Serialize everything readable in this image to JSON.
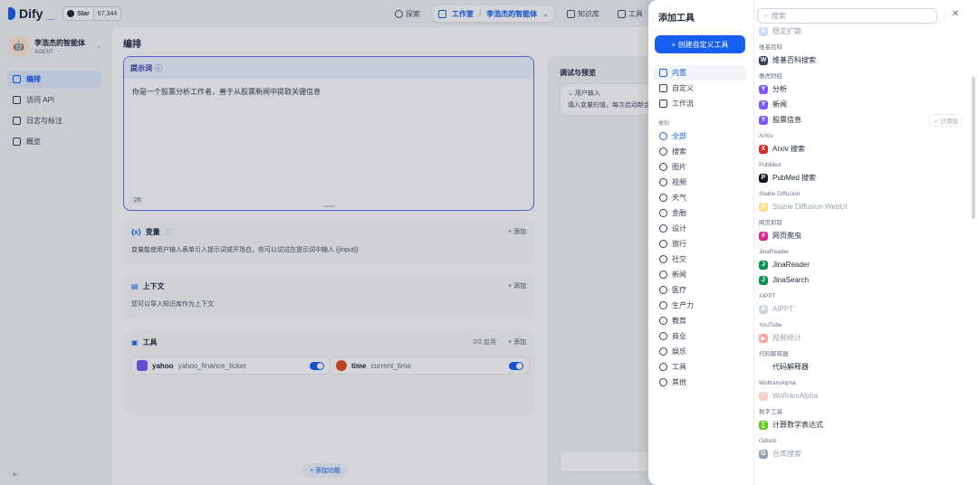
{
  "header": {
    "logo_text": "Dify",
    "logo_underscore": "_",
    "star_label": "Star",
    "star_count": "67,344",
    "nav": [
      {
        "label": "探索",
        "icon": "compass-icon"
      },
      {
        "label": "工作室",
        "icon": "studio-icon"
      },
      {
        "label": "李浩杰的智能体",
        "icon": "chevron-down-icon"
      },
      {
        "label": "知识库",
        "icon": "book-icon"
      },
      {
        "label": "工具",
        "icon": "tool-icon"
      }
    ]
  },
  "sidebar": {
    "app_name": "李浩杰的智能体",
    "app_tag": "AGENT",
    "items": [
      {
        "label": "编排",
        "icon": "orchestrate-icon"
      },
      {
        "label": "访问 API",
        "icon": "api-icon"
      },
      {
        "label": "日志与标注",
        "icon": "log-icon"
      },
      {
        "label": "概览",
        "icon": "overview-icon"
      }
    ],
    "collapse_icon": "collapse-icon"
  },
  "main": {
    "title": "编排",
    "prompt": {
      "label": "提示词",
      "text": "你是一个股票分析工作者，善于从股票新闻中提取关键信息",
      "count": "26"
    },
    "variables": {
      "title": "变量",
      "add": "+ 添加",
      "desc": "变量能使用户输入表单引入提示词或开场白，你可以试试在提示词中输入 {{input}}"
    },
    "context": {
      "title": "上下文",
      "add": "+ 添加",
      "desc": "您可以导入知识库作为上下文"
    },
    "tools": {
      "title": "工具",
      "count": "2/2 启用",
      "add": "+ 添加",
      "items": [
        {
          "name": "yahoo",
          "sub": "yahoo_finance_ticker",
          "color": "#7a5af8"
        },
        {
          "name": "time",
          "sub": "current_time",
          "color": "#e04f16"
        }
      ]
    },
    "add_feature": "+ 添加功能",
    "debug": {
      "title": "调试与预览",
      "user_input": "用户输入",
      "user_input_desc": "填入变量的值，每次启动新会"
    }
  },
  "panel": {
    "title": "添加工具",
    "create_button": "+ 创建自定义工具",
    "types": [
      {
        "label": "内置",
        "icon": "builtin-icon"
      },
      {
        "label": "自定义",
        "icon": "custom-icon"
      },
      {
        "label": "工作流",
        "icon": "workflow-icon"
      }
    ],
    "category_label": "类别",
    "categories": [
      {
        "label": "全部",
        "icon": "grid-icon"
      },
      {
        "label": "搜索",
        "icon": "search-icon"
      },
      {
        "label": "图片",
        "icon": "image-icon"
      },
      {
        "label": "视频",
        "icon": "video-icon"
      },
      {
        "label": "天气",
        "icon": "weather-icon"
      },
      {
        "label": "金融",
        "icon": "finance-icon"
      },
      {
        "label": "设计",
        "icon": "design-icon"
      },
      {
        "label": "旅行",
        "icon": "travel-icon"
      },
      {
        "label": "社交",
        "icon": "social-icon"
      },
      {
        "label": "新闻",
        "icon": "news-icon"
      },
      {
        "label": "医疗",
        "icon": "medical-icon"
      },
      {
        "label": "生产力",
        "icon": "productivity-icon"
      },
      {
        "label": "教育",
        "icon": "education-icon"
      },
      {
        "label": "商业",
        "icon": "business-icon"
      },
      {
        "label": "娱乐",
        "icon": "entertainment-icon"
      },
      {
        "label": "工具",
        "icon": "tool-icon"
      },
      {
        "label": "其他",
        "icon": "other-icon"
      }
    ],
    "search_placeholder": "搜索",
    "groups": [
      {
        "label": "",
        "tools": [
          {
            "name": "稳定扩散",
            "icon": "S",
            "color": "#c7d7fe",
            "dim": true
          }
        ]
      },
      {
        "label": "维基百科",
        "tools": [
          {
            "name": "维基百科搜索",
            "icon": "W",
            "color": "#344054"
          }
        ]
      },
      {
        "label": "雅虎财经",
        "tools": [
          {
            "name": "分析",
            "icon": "Y",
            "color": "#7a5af8"
          },
          {
            "name": "新闻",
            "icon": "Y",
            "color": "#7a5af8"
          },
          {
            "name": "股票信息",
            "icon": "Y",
            "color": "#7a5af8",
            "added": "✓ 已添加"
          }
        ]
      },
      {
        "label": "ArXiv",
        "tools": [
          {
            "name": "Arxiv 搜索",
            "icon": "X",
            "color": "#d92d20"
          }
        ]
      },
      {
        "label": "PubMed",
        "tools": [
          {
            "name": "PubMed 搜索",
            "icon": "P",
            "color": "#101828"
          }
        ]
      },
      {
        "label": "Stable Diffusion",
        "tools": [
          {
            "name": "Stable Diffusion WebUI",
            "icon": "S",
            "color": "#fedf89",
            "dim": true
          }
        ]
      },
      {
        "label": "网页抓取",
        "tools": [
          {
            "name": "网页爬虫",
            "icon": "#",
            "color": "#dd2590"
          }
        ]
      },
      {
        "label": "JinaReader",
        "tools": [
          {
            "name": "JinaReader",
            "icon": "J",
            "color": "#099250"
          },
          {
            "name": "JinaSearch",
            "icon": "J",
            "color": "#099250"
          }
        ]
      },
      {
        "label": "AIPPT",
        "tools": [
          {
            "name": "AIPPT",
            "icon": "A",
            "color": "#d0d5dd",
            "dim": true
          }
        ]
      },
      {
        "label": "YouTube",
        "tools": [
          {
            "name": "视频统计",
            "icon": "▶",
            "color": "#fda29b",
            "dim": true
          }
        ]
      },
      {
        "label": "代码解释器",
        "tools": [
          {
            "name": "代码解释器",
            "icon": "</>",
            "color": "#ffffff"
          }
        ]
      },
      {
        "label": "WolframAlpha",
        "tools": [
          {
            "name": "WolframAlpha",
            "icon": "*",
            "color": "#fecdca",
            "dim": true
          }
        ]
      },
      {
        "label": "数字工具",
        "tools": [
          {
            "name": "计算数学表达式",
            "icon": "∑",
            "color": "#66c61c"
          }
        ]
      },
      {
        "label": "Github",
        "tools": [
          {
            "name": "仓库搜索",
            "icon": "G",
            "color": "#98a2b3",
            "dim": true
          }
        ]
      }
    ]
  }
}
